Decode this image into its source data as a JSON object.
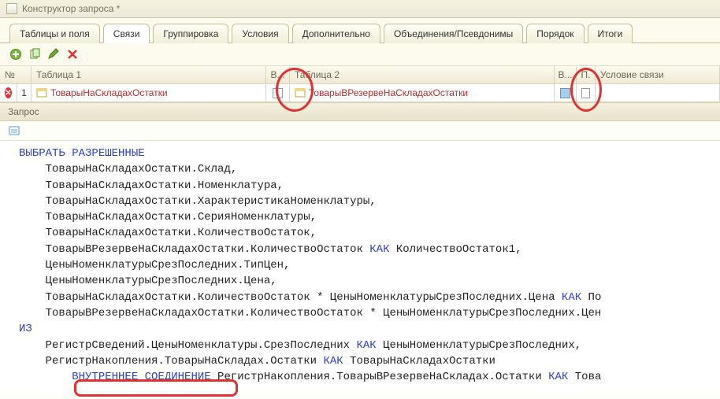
{
  "window": {
    "title": "Конструктор запроса *"
  },
  "tabs": {
    "t0": "Таблицы и поля",
    "t1": "Связи",
    "t2": "Группировка",
    "t3": "Условия",
    "t4": "Дополнительно",
    "t5": "Объединения/Псевдонимы",
    "t6": "Порядок",
    "t7": "Итоги"
  },
  "grid": {
    "h_num": "№",
    "h_t1": "Таблица 1",
    "h_v1": "В...",
    "h_t2": "Таблица 2",
    "h_v2": "В...",
    "h_p": "П.",
    "h_cond": "Условие связи",
    "row1": {
      "idx": "1",
      "t1": "ТоварыНаСкладахОстатки",
      "t2": "ТоварыВРезервеНаСкладахОстатки"
    }
  },
  "section_query": "Запрос",
  "query": {
    "kw_select": "ВЫБРАТЬ РАЗРЕШЕННЫЕ",
    "l1": "ТоварыНаСкладахОстатки.Склад,",
    "l2": "ТоварыНаСкладахОстатки.Номенклатура,",
    "l3": "ТоварыНаСкладахОстатки.ХарактеристикаНоменклатуры,",
    "l4": "ТоварыНаСкладахОстатки.СерияНоменклатуры,",
    "l5": "ТоварыНаСкладахОстатки.КоличествоОстаток,",
    "l6a": "ТоварыВРезервеНаСкладахОстатки.КоличествоОстаток ",
    "l6kw": "КАК",
    "l6b": " КоличествоОстаток1,",
    "l7": "ЦеныНоменклатурыСрезПоследних.ТипЦен,",
    "l8": "ЦеныНоменклатурыСрезПоследних.Цена,",
    "l9a": "ТоварыНаСкладахОстатки.КоличествоОстаток * ЦеныНоменклатурыСрезПоследних.Цена ",
    "l9kw": "КАК",
    "l9b": " По",
    "l10": "ТоварыВРезервеНаСкладахОстатки.КоличествоОстаток * ЦеныНоменклатурыСрезПоследних.Цен",
    "kw_from": "ИЗ",
    "l11a": "РегистрСведений.ЦеныНоменклатуры.СрезПоследних ",
    "l11kw": "КАК",
    "l11b": " ЦеныНоменклатурыСрезПоследних,",
    "l12a": "РегистрНакопления.ТоварыНаСкладах.Остатки ",
    "l12kw": "КАК",
    "l12b": " ТоварыНаСкладахОстатки",
    "l13kw": "ВНУТРЕННЕЕ СОЕДИНЕНИЕ",
    "l13a": " РегистрНакопления.ТоварыВРезервеНаСкладах.Остатки ",
    "l13kw2": "КАК",
    "l13b": " Това"
  }
}
